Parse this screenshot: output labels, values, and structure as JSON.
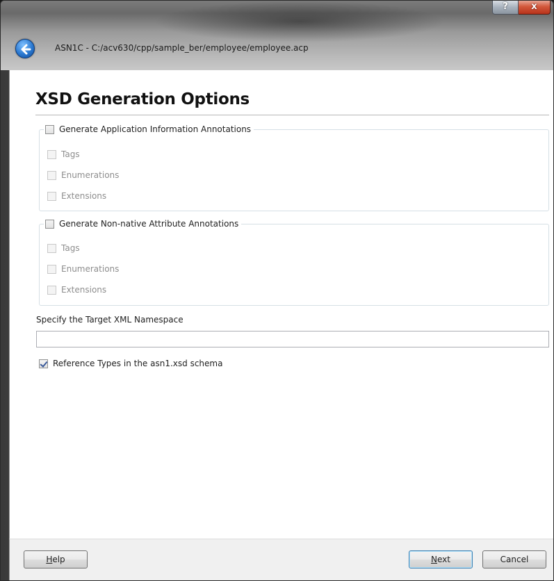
{
  "window": {
    "title": "ASN1C - C:/acv630/cpp/sample_ber/employee/employee.acp",
    "help_glyph": "?",
    "close_glyph": "x"
  },
  "page": {
    "title": "XSD Generation Options"
  },
  "group_app_info": {
    "label": "Generate Application Information Annotations",
    "checked": false,
    "options": [
      {
        "label": "Tags",
        "checked": false
      },
      {
        "label": "Enumerations",
        "checked": false
      },
      {
        "label": "Extensions",
        "checked": false
      }
    ]
  },
  "group_non_native": {
    "label": "Generate Non-native Attribute Annotations",
    "checked": false,
    "options": [
      {
        "label": "Tags",
        "checked": false
      },
      {
        "label": "Enumerations",
        "checked": false
      },
      {
        "label": "Extensions",
        "checked": false
      }
    ]
  },
  "namespace": {
    "label": "Specify the Target XML Namespace",
    "value": ""
  },
  "reference_types": {
    "label": "Reference Types in the asn1.xsd schema",
    "checked": true
  },
  "footer": {
    "help_hotkey": "H",
    "help_rest": "elp",
    "next_hotkey": "N",
    "next_rest": "ext",
    "cancel_label": "Cancel"
  }
}
